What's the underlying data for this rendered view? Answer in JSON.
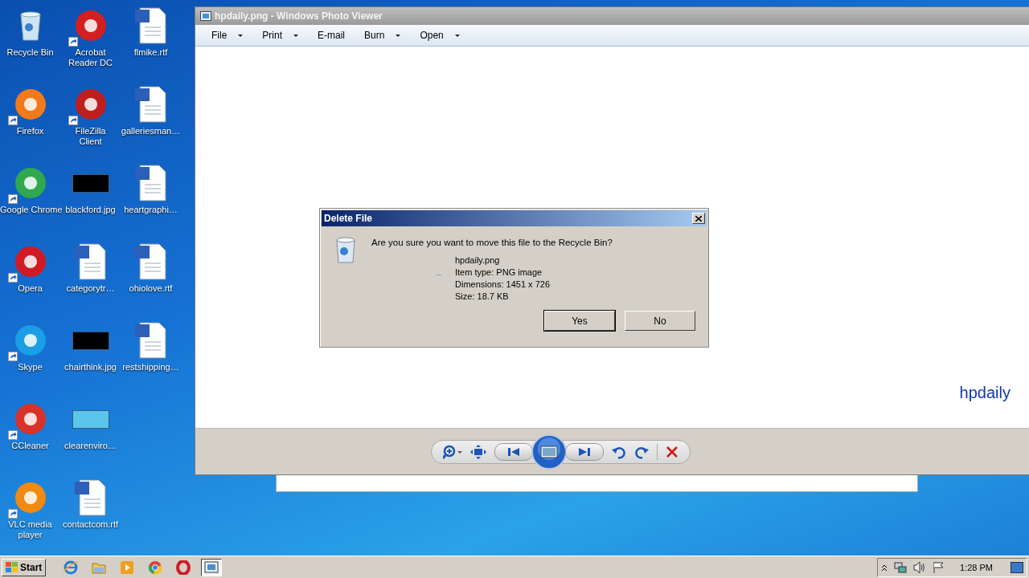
{
  "desktop": {
    "icons": [
      {
        "label": "Recycle Bin",
        "kind": "bin",
        "shortcut": false
      },
      {
        "label": "Firefox",
        "kind": "app",
        "color": "#f27a1a",
        "shortcut": true
      },
      {
        "label": "Google Chrome",
        "kind": "app",
        "color": "#2fa84f",
        "shortcut": true
      },
      {
        "label": "Opera",
        "kind": "app",
        "color": "#d01b24",
        "shortcut": true
      },
      {
        "label": "Skype",
        "kind": "app",
        "color": "#1a9ee6",
        "shortcut": true
      },
      {
        "label": "CCleaner",
        "kind": "app",
        "color": "#d8322a",
        "shortcut": true
      },
      {
        "label": "VLC media player",
        "kind": "app",
        "color": "#f08a10",
        "shortcut": true
      },
      {
        "label": "Acrobat Reader DC",
        "kind": "app",
        "color": "#d21f1f",
        "shortcut": true
      },
      {
        "label": "FileZilla Client",
        "kind": "app",
        "color": "#bf1e1e",
        "shortcut": true
      },
      {
        "label": "blackford.jpg",
        "kind": "image",
        "color": "#000000",
        "shortcut": false
      },
      {
        "label": "categorytr…",
        "kind": "doc",
        "shortcut": false
      },
      {
        "label": "chairthink.jpg",
        "kind": "image",
        "color": "#000000",
        "shortcut": false
      },
      {
        "label": "clearenviro…",
        "kind": "image",
        "color": "#5bc6ea",
        "shortcut": false
      },
      {
        "label": "contactcom.rtf",
        "kind": "doc",
        "shortcut": false
      },
      {
        "label": "flmike.rtf",
        "kind": "doc",
        "shortcut": false
      },
      {
        "label": "galleriesman…",
        "kind": "doc",
        "shortcut": false
      },
      {
        "label": "heartgraphi…",
        "kind": "doc",
        "shortcut": false
      },
      {
        "label": "ohiolove.rtf",
        "kind": "doc",
        "shortcut": false
      },
      {
        "label": "restshipping…",
        "kind": "doc",
        "shortcut": false
      }
    ]
  },
  "viewer": {
    "title": "hpdaily.png - Windows Photo Viewer",
    "menu": [
      {
        "label": "File",
        "dropdown": true
      },
      {
        "label": "Print",
        "dropdown": true
      },
      {
        "label": "E-mail",
        "dropdown": false
      },
      {
        "label": "Burn",
        "dropdown": true
      },
      {
        "label": "Open",
        "dropdown": true
      }
    ],
    "image_text": "hpdaily",
    "toolbar": [
      {
        "kind": "zoom"
      },
      {
        "kind": "fit"
      },
      {
        "kind": "prev"
      },
      {
        "kind": "slideshow"
      },
      {
        "kind": "next"
      },
      {
        "kind": "rotate-left"
      },
      {
        "kind": "rotate-right"
      },
      {
        "kind": "delete"
      }
    ]
  },
  "dialog": {
    "title": "Delete File",
    "message": "Are you sure you want to move this file to the Recycle Bin?",
    "details": [
      "hpdaily.png",
      "Item type: PNG image",
      "Dimensions: 1451 x 726",
      "Size: 18.7 KB"
    ],
    "buttons": [
      {
        "label": "Yes",
        "selected": true
      },
      {
        "label": "No",
        "selected": false
      }
    ]
  },
  "taskbar": {
    "start": "Start",
    "items": [
      {
        "kind": "ie",
        "selected": false
      },
      {
        "kind": "folder",
        "selected": false
      },
      {
        "kind": "media",
        "selected": false
      },
      {
        "kind": "chrome",
        "selected": false
      },
      {
        "kind": "opera",
        "selected": false
      },
      {
        "kind": "viewer",
        "selected": true
      }
    ],
    "clock": "1:28 PM"
  }
}
